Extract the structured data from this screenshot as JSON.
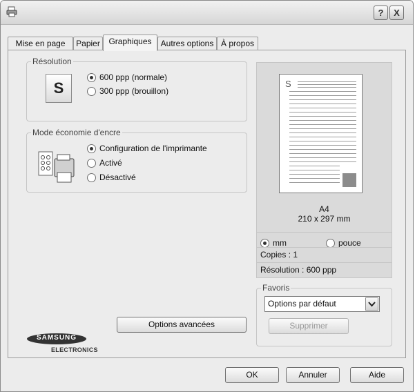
{
  "title_bar": {
    "help_label": "?",
    "close_label": "X"
  },
  "tabs": [
    {
      "label": "Mise en page"
    },
    {
      "label": "Papier"
    },
    {
      "label": "Graphiques"
    },
    {
      "label": "Autres options"
    },
    {
      "label": "À propos"
    }
  ],
  "resolution": {
    "legend": "Résolution",
    "icon_letter": "S",
    "options": [
      {
        "label": "600 ppp (normale)",
        "selected": true
      },
      {
        "label": "300 ppp (brouillon)",
        "selected": false
      }
    ]
  },
  "ink_saving": {
    "legend": "Mode économie d'encre",
    "options": [
      {
        "label": "Configuration de l'imprimante",
        "selected": true
      },
      {
        "label": "Activé",
        "selected": false
      },
      {
        "label": "Désactivé",
        "selected": false
      }
    ]
  },
  "advanced_button": "Options avancées",
  "preview": {
    "page_letter": "S",
    "paper_name": "A4",
    "paper_size": "210 x 297 mm",
    "units": [
      {
        "label": "mm",
        "selected": true
      },
      {
        "label": "pouce",
        "selected": false
      }
    ],
    "copies": "Copies : 1",
    "resolution": "Résolution : 600 ppp"
  },
  "favorites": {
    "legend": "Favoris",
    "selected": "Options par défaut",
    "delete_label": "Supprimer"
  },
  "logo": {
    "brand": "SAMSUNG",
    "sub": "ELECTRONICS"
  },
  "footer": {
    "ok": "OK",
    "cancel": "Annuler",
    "help": "Aide"
  }
}
